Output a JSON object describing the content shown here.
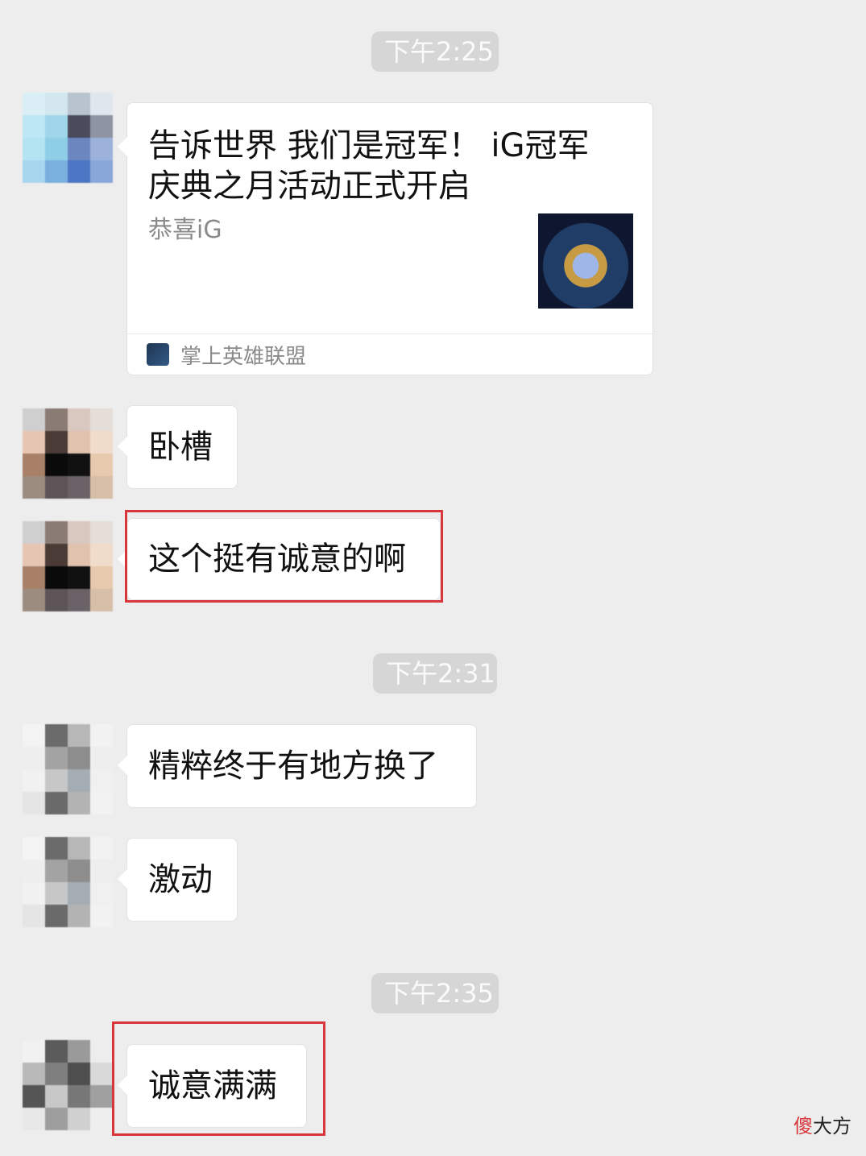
{
  "timestamps": [
    "下午2:25",
    "下午2:31",
    "下午2:35"
  ],
  "share_card": {
    "title": "告诉世界 我们是冠军！ iG冠军庆典之月活动正式开启",
    "description": "恭喜iG",
    "source": "掌上英雄联盟"
  },
  "messages": [
    {
      "text": "卧槽"
    },
    {
      "text": "这个挺有诚意的啊"
    },
    {
      "text": "精粹终于有地方换了"
    },
    {
      "text": "激动"
    },
    {
      "text": "诚意满满"
    }
  ],
  "watermark": {
    "accent": "傻",
    "rest": "大方"
  },
  "colors": {
    "highlight": "#d8363a",
    "background": "#ededed",
    "bubble": "#ffffff"
  }
}
